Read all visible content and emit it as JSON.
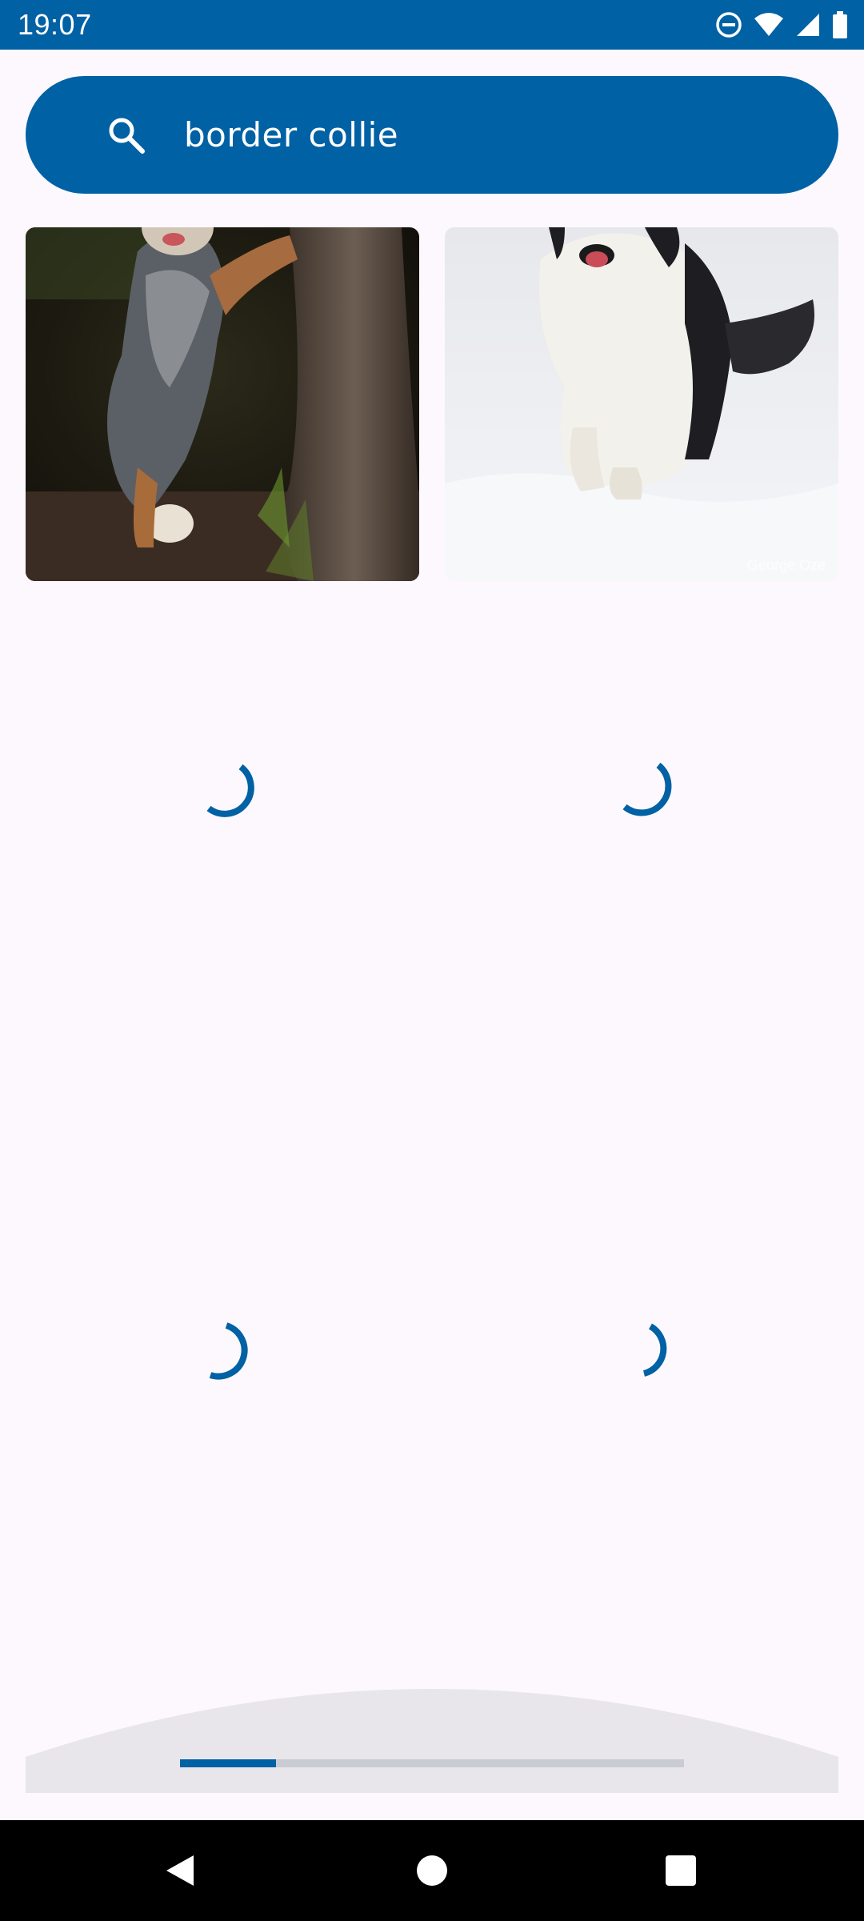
{
  "status_bar": {
    "time": "19:07",
    "icons": [
      "do-not-disturb-icon",
      "wifi-icon",
      "cellular-signal-icon",
      "battery-icon"
    ]
  },
  "search": {
    "query": "border collie",
    "icon": "search-icon"
  },
  "results": [
    {
      "kind": "image",
      "subject": "merle border collie standing against tree trunk"
    },
    {
      "kind": "image",
      "subject": "black and white border collie running in snow",
      "watermark": "George Oze"
    },
    {
      "kind": "loading"
    },
    {
      "kind": "loading"
    },
    {
      "kind": "loading"
    },
    {
      "kind": "loading"
    }
  ],
  "loading_progress": 0.19,
  "navigation": {
    "back": "back-icon",
    "home": "home-icon",
    "recents": "recents-icon"
  },
  "colors": {
    "primary": "#0061a4",
    "background": "#fcf8fd",
    "track": "#c9ccd3"
  }
}
